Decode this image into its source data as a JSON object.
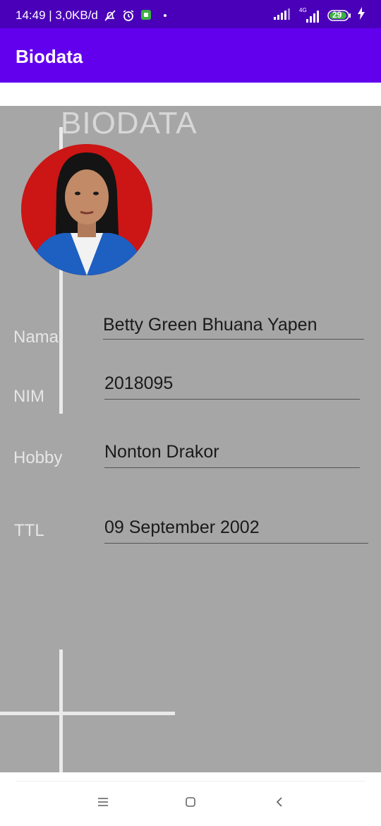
{
  "status_bar": {
    "time_speed": "14:49 | 3,0KB/d",
    "network_label": "4G",
    "battery": "29",
    "icons": [
      "bell-off-icon",
      "alarm-icon",
      "app-icon",
      "dot-icon",
      "signal-icon",
      "battery-icon",
      "charging-icon"
    ]
  },
  "app_bar": {
    "title": "Biodata"
  },
  "content": {
    "heading": "BIODATA",
    "fields": [
      {
        "label": "Nama",
        "value": "Betty Green Bhuana Yapen"
      },
      {
        "label": "NIM",
        "value": "2018095"
      },
      {
        "label": "Hobby",
        "value": "Nonton Drakor"
      },
      {
        "label": "TTL",
        "value": "09 September 2002"
      }
    ]
  },
  "nav_bar": {
    "icons": [
      "menu-icon",
      "home-icon",
      "back-icon"
    ]
  }
}
